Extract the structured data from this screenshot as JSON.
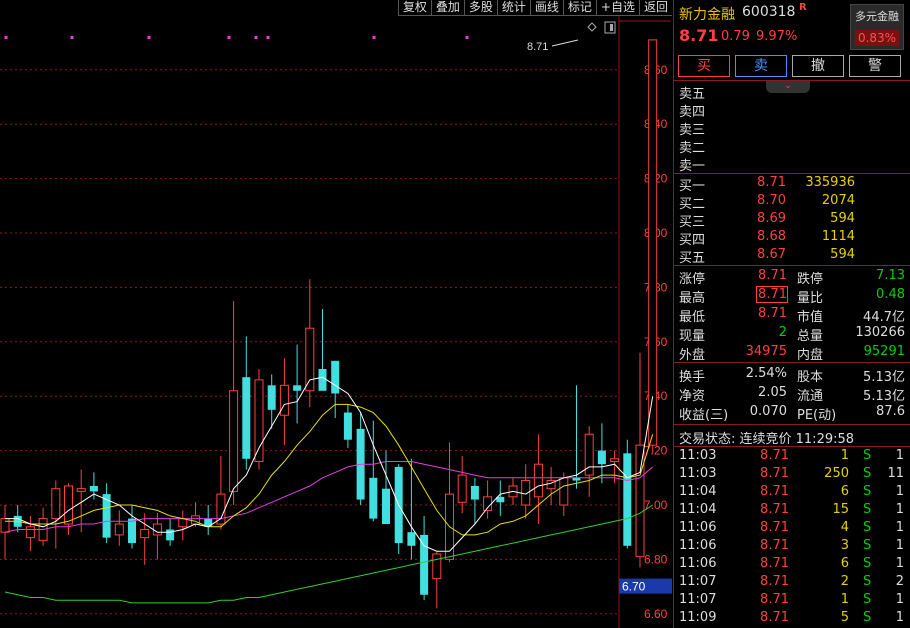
{
  "toolbar": {
    "items": [
      "复权",
      "叠加",
      "多股",
      "统计",
      "画线",
      "标记",
      "+自选",
      "返回"
    ]
  },
  "chart": {
    "y_ticks": [
      "8.60",
      "8.40",
      "8.20",
      "8.00",
      "7.80",
      "7.60",
      "7.40",
      "7.20",
      "7.00",
      "6.80",
      "6.60"
    ],
    "cursor_price": "6.70",
    "high_annotation": "8.71",
    "colors": {
      "up": "#ff4040",
      "down": "#40e0e0",
      "ma5": "#ffffff",
      "ma10": "#e8e000",
      "ma20": "#e040e0",
      "ma60": "#30d030",
      "grid": "#8b1a1a"
    }
  },
  "chart_data": {
    "type": "candlestick",
    "y_range": [
      6.6,
      8.75
    ],
    "candles": [
      {
        "o": 6.9,
        "h": 7.0,
        "l": 6.8,
        "c": 6.95
      },
      {
        "o": 6.96,
        "h": 7.0,
        "l": 6.9,
        "c": 6.92
      },
      {
        "o": 6.88,
        "h": 6.96,
        "l": 6.83,
        "c": 6.92
      },
      {
        "o": 6.87,
        "h": 6.99,
        "l": 6.85,
        "c": 6.95
      },
      {
        "o": 6.95,
        "h": 7.09,
        "l": 6.84,
        "c": 7.06
      },
      {
        "o": 6.93,
        "h": 7.08,
        "l": 6.89,
        "c": 7.07
      },
      {
        "o": 7.05,
        "h": 7.13,
        "l": 6.9,
        "c": 7.06
      },
      {
        "o": 7.07,
        "h": 7.12,
        "l": 7.02,
        "c": 7.05
      },
      {
        "o": 7.04,
        "h": 7.08,
        "l": 6.86,
        "c": 6.88
      },
      {
        "o": 6.89,
        "h": 6.98,
        "l": 6.85,
        "c": 6.93
      },
      {
        "o": 6.95,
        "h": 7.0,
        "l": 6.84,
        "c": 6.86
      },
      {
        "o": 6.88,
        "h": 6.97,
        "l": 6.78,
        "c": 6.91
      },
      {
        "o": 6.89,
        "h": 6.97,
        "l": 6.8,
        "c": 6.93
      },
      {
        "o": 6.91,
        "h": 6.95,
        "l": 6.85,
        "c": 6.87
      },
      {
        "o": 6.92,
        "h": 6.98,
        "l": 6.87,
        "c": 6.95
      },
      {
        "o": 6.93,
        "h": 7.01,
        "l": 6.92,
        "c": 6.96
      },
      {
        "o": 6.95,
        "h": 7.0,
        "l": 6.89,
        "c": 6.92
      },
      {
        "o": 6.93,
        "h": 7.18,
        "l": 6.91,
        "c": 7.04
      },
      {
        "o": 7.05,
        "h": 7.75,
        "l": 7.0,
        "c": 7.42
      },
      {
        "o": 7.47,
        "h": 7.62,
        "l": 7.13,
        "c": 7.17
      },
      {
        "o": 7.16,
        "h": 7.5,
        "l": 7.13,
        "c": 7.46
      },
      {
        "o": 7.44,
        "h": 7.48,
        "l": 7.28,
        "c": 7.35
      },
      {
        "o": 7.33,
        "h": 7.54,
        "l": 7.22,
        "c": 7.44
      },
      {
        "o": 7.44,
        "h": 7.59,
        "l": 7.3,
        "c": 7.42
      },
      {
        "o": 7.42,
        "h": 7.83,
        "l": 7.36,
        "c": 7.65
      },
      {
        "o": 7.5,
        "h": 7.72,
        "l": 7.42,
        "c": 7.42
      },
      {
        "o": 7.53,
        "h": 7.53,
        "l": 7.32,
        "c": 7.41
      },
      {
        "o": 7.34,
        "h": 7.37,
        "l": 7.21,
        "c": 7.24
      },
      {
        "o": 7.28,
        "h": 7.34,
        "l": 7.0,
        "c": 7.02
      },
      {
        "o": 7.1,
        "h": 7.31,
        "l": 6.94,
        "c": 6.95
      },
      {
        "o": 7.06,
        "h": 7.2,
        "l": 6.93,
        "c": 6.93
      },
      {
        "o": 7.14,
        "h": 7.15,
        "l": 6.82,
        "c": 6.86
      },
      {
        "o": 6.9,
        "h": 7.17,
        "l": 6.8,
        "c": 6.85
      },
      {
        "o": 6.89,
        "h": 6.96,
        "l": 6.65,
        "c": 6.67
      },
      {
        "o": 6.73,
        "h": 6.83,
        "l": 6.62,
        "c": 6.82
      },
      {
        "o": 6.8,
        "h": 7.23,
        "l": 6.79,
        "c": 7.04
      },
      {
        "o": 7.01,
        "h": 7.18,
        "l": 6.97,
        "c": 7.11
      },
      {
        "o": 7.07,
        "h": 7.1,
        "l": 6.93,
        "c": 7.02
      },
      {
        "o": 6.98,
        "h": 7.09,
        "l": 6.95,
        "c": 7.03
      },
      {
        "o": 7.03,
        "h": 7.09,
        "l": 6.96,
        "c": 7.01
      },
      {
        "o": 7.03,
        "h": 7.1,
        "l": 7.0,
        "c": 7.07
      },
      {
        "o": 7.0,
        "h": 7.15,
        "l": 6.95,
        "c": 7.09
      },
      {
        "o": 7.03,
        "h": 7.26,
        "l": 6.93,
        "c": 7.15
      },
      {
        "o": 7.06,
        "h": 7.14,
        "l": 7.0,
        "c": 7.09
      },
      {
        "o": 7.0,
        "h": 7.12,
        "l": 6.96,
        "c": 7.1
      },
      {
        "o": 7.1,
        "h": 7.44,
        "l": 7.06,
        "c": 7.09
      },
      {
        "o": 7.11,
        "h": 7.29,
        "l": 7.03,
        "c": 7.26
      },
      {
        "o": 7.2,
        "h": 7.3,
        "l": 7.08,
        "c": 7.15
      },
      {
        "o": 7.16,
        "h": 7.2,
        "l": 7.08,
        "c": 7.17
      },
      {
        "o": 7.19,
        "h": 7.24,
        "l": 6.84,
        "c": 6.85
      },
      {
        "o": 6.81,
        "h": 7.56,
        "l": 6.77,
        "c": 7.22
      },
      {
        "o": 7.22,
        "h": 8.71,
        "l": 7.19,
        "c": 8.71
      }
    ],
    "ma5": [
      6.95,
      6.95,
      6.93,
      6.92,
      6.94,
      6.98,
      7.01,
      7.04,
      7.02,
      7.0,
      6.96,
      6.93,
      6.9,
      6.9,
      6.91,
      6.93,
      6.92,
      6.95,
      7.06,
      7.11,
      7.21,
      7.29,
      7.37,
      7.38,
      7.46,
      7.47,
      7.44,
      7.41,
      7.34,
      7.22,
      7.11,
      7.0,
      6.92,
      6.85,
      6.83,
      6.83,
      6.88,
      6.93,
      6.99,
      7.04,
      7.05,
      7.04,
      7.07,
      7.08,
      7.1,
      7.11,
      7.14,
      7.14,
      7.15,
      7.1,
      7.12,
      7.4
    ],
    "ma10": [
      6.94,
      6.94,
      6.93,
      6.93,
      6.93,
      6.94,
      6.96,
      6.98,
      6.99,
      7.0,
      7.0,
      6.99,
      6.98,
      6.96,
      6.95,
      6.94,
      6.92,
      6.92,
      6.96,
      6.99,
      7.04,
      7.11,
      7.16,
      7.22,
      7.27,
      7.33,
      7.37,
      7.37,
      7.36,
      7.34,
      7.29,
      7.22,
      7.14,
      7.06,
      6.98,
      6.92,
      6.89,
      6.89,
      6.9,
      6.93,
      6.94,
      6.96,
      7.0,
      7.04,
      7.07,
      7.08,
      7.09,
      7.11,
      7.11,
      7.1,
      7.11,
      7.26
    ],
    "ma20": [
      6.9,
      6.91,
      6.91,
      6.91,
      6.92,
      6.92,
      6.93,
      6.93,
      6.94,
      6.94,
      6.94,
      6.95,
      6.95,
      6.95,
      6.95,
      6.95,
      6.95,
      6.95,
      6.96,
      6.97,
      6.99,
      7.01,
      7.03,
      7.05,
      7.07,
      7.1,
      7.12,
      7.14,
      7.15,
      7.15,
      7.16,
      7.16,
      7.16,
      7.15,
      7.14,
      7.13,
      7.12,
      7.11,
      7.1,
      7.1,
      7.1,
      7.1,
      7.1,
      7.1,
      7.1,
      7.1,
      7.1,
      7.1,
      7.1,
      7.09,
      7.1,
      7.14
    ],
    "ma60": [
      6.68,
      6.67,
      6.66,
      6.66,
      6.65,
      6.65,
      6.65,
      6.65,
      6.65,
      6.65,
      6.64,
      6.64,
      6.64,
      6.64,
      6.64,
      6.64,
      6.64,
      6.65,
      6.65,
      6.66,
      6.66,
      6.67,
      6.68,
      6.69,
      6.7,
      6.71,
      6.72,
      6.73,
      6.74,
      6.75,
      6.76,
      6.77,
      6.78,
      6.79,
      6.8,
      6.81,
      6.82,
      6.83,
      6.84,
      6.85,
      6.86,
      6.87,
      6.88,
      6.89,
      6.9,
      6.91,
      6.92,
      6.93,
      6.94,
      6.95,
      6.97,
      7.0
    ]
  },
  "quote": {
    "name": "新力金融",
    "code": "600318",
    "r_mark": "R",
    "price": "8.71",
    "change": "0.79",
    "change_pct": "9.97%",
    "sector_name": "多元金融",
    "sector_pct": "0.83%"
  },
  "buttons": {
    "buy": "买",
    "sell": "卖",
    "cancel": "撤",
    "alert": "警"
  },
  "collapse_tab": "⌄",
  "asks": [
    {
      "label": "卖五",
      "price": "",
      "vol": ""
    },
    {
      "label": "卖四",
      "price": "",
      "vol": ""
    },
    {
      "label": "卖三",
      "price": "",
      "vol": ""
    },
    {
      "label": "卖二",
      "price": "",
      "vol": ""
    },
    {
      "label": "卖一",
      "price": "",
      "vol": ""
    }
  ],
  "bids": [
    {
      "label": "买一",
      "price": "8.71",
      "vol": "335936"
    },
    {
      "label": "买二",
      "price": "8.70",
      "vol": "2074"
    },
    {
      "label": "买三",
      "price": "8.69",
      "vol": "594"
    },
    {
      "label": "买四",
      "price": "8.68",
      "vol": "1114"
    },
    {
      "label": "买五",
      "price": "8.67",
      "vol": "594"
    }
  ],
  "stats1": [
    {
      "l1": "涨停",
      "v1": "8.71",
      "l2": "跌停",
      "v2": "7.13"
    },
    {
      "l1": "最高",
      "v1": "8.71",
      "l2": "量比",
      "v2": "0.48"
    },
    {
      "l1": "最低",
      "v1": "8.71",
      "l2": "市值",
      "v2": "44.7亿"
    },
    {
      "l1": "现量",
      "v1": "2",
      "l2": "总量",
      "v2": "130266"
    },
    {
      "l1": "外盘",
      "v1": "34975",
      "l2": "内盘",
      "v2": "95291"
    }
  ],
  "stats2": [
    {
      "l1": "换手",
      "v1": "2.54%",
      "l2": "股本",
      "v2": "5.13亿"
    },
    {
      "l1": "净资",
      "v1": "2.05",
      "l2": "流通",
      "v2": "5.13亿"
    },
    {
      "l1": "收益(三)",
      "v1": "0.070",
      "l2": "PE(动)",
      "v2": "87.6"
    }
  ],
  "trade_status": "交易状态: 连续竞价 11:29:58",
  "trades": [
    {
      "time": "11:03",
      "price": "8.71",
      "vol": "1",
      "side": "S",
      "n": "1"
    },
    {
      "time": "11:03",
      "price": "8.71",
      "vol": "250",
      "side": "S",
      "n": "11"
    },
    {
      "time": "11:04",
      "price": "8.71",
      "vol": "6",
      "side": "S",
      "n": "1"
    },
    {
      "time": "11:04",
      "price": "8.71",
      "vol": "15",
      "side": "S",
      "n": "1"
    },
    {
      "time": "11:06",
      "price": "8.71",
      "vol": "4",
      "side": "S",
      "n": "1"
    },
    {
      "time": "11:06",
      "price": "8.71",
      "vol": "3",
      "side": "S",
      "n": "1"
    },
    {
      "time": "11:06",
      "price": "8.71",
      "vol": "6",
      "side": "S",
      "n": "1"
    },
    {
      "time": "11:07",
      "price": "8.71",
      "vol": "2",
      "side": "S",
      "n": "2"
    },
    {
      "time": "11:07",
      "price": "8.71",
      "vol": "1",
      "side": "S",
      "n": "1"
    },
    {
      "time": "11:09",
      "price": "8.71",
      "vol": "5",
      "side": "S",
      "n": "1"
    }
  ]
}
